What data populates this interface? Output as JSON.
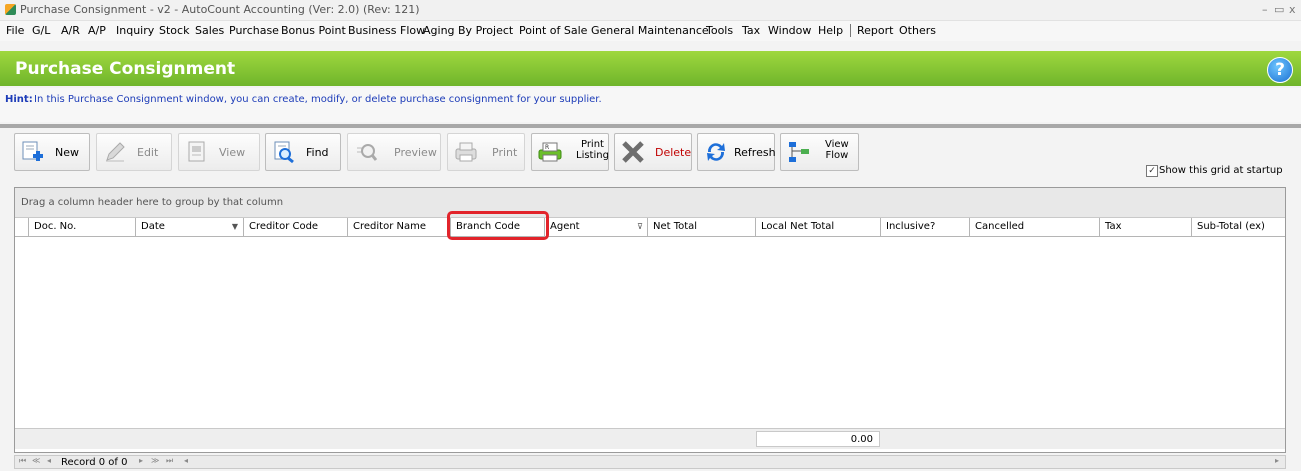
{
  "window": {
    "title": "Purchase Consignment - v2 - AutoCount Accounting (Ver: 2.0) (Rev: 121)",
    "controls": [
      "–",
      "▭",
      "x"
    ]
  },
  "menu": {
    "items": [
      "File",
      "G/L",
      "A/R",
      "A/P",
      "Inquiry",
      "Stock",
      "Sales",
      "Purchase",
      "Bonus Point",
      "Business Flow",
      "Aging By Project",
      "Point of Sale",
      "General Maintenance",
      "Tools",
      "Tax",
      "Window",
      "Help"
    ],
    "extra_items": [
      "Report",
      "Others"
    ]
  },
  "header": {
    "title": "Purchase Consignment",
    "help_label": "?"
  },
  "hint": {
    "label": "Hint:",
    "text": "In this Purchase Consignment window, you can create, modify, or delete purchase consignment for your supplier."
  },
  "toolbar": {
    "new": "New",
    "edit": "Edit",
    "view": "View",
    "find": "Find",
    "preview": "Preview",
    "print": "Print",
    "print_listing_1": "Print",
    "print_listing_2": "Listing",
    "delete": "Delete",
    "refresh": "Refresh",
    "view_flow_1": "View",
    "view_flow_2": "Flow",
    "show_grid_label": "Show this grid at startup",
    "show_grid_checked": true
  },
  "grid": {
    "group_hint": "Drag a column header here to group by that column",
    "columns": [
      "Doc. No.",
      "Date",
      "Creditor Code",
      "Creditor Name",
      "Branch Code",
      "Agent",
      "Net Total",
      "Local Net Total",
      "Inclusive?",
      "Cancelled",
      "Tax",
      "Sub-Total (ex)"
    ],
    "highlighted_column": "Branch Code",
    "footer_total": "0.00"
  },
  "navigator": {
    "record_text": "Record 0 of 0",
    "left_glyphs": [
      "⏮",
      "≪",
      "◂"
    ],
    "right_glyphs": [
      "▸",
      "≫",
      "⏭"
    ],
    "scroll_left": "◂",
    "scroll_right": "▸"
  },
  "colors": {
    "header_green": "#7cc030",
    "hint_blue": "#1d3cb8",
    "delete_red": "#c00000",
    "highlight_red": "#e2242b"
  }
}
